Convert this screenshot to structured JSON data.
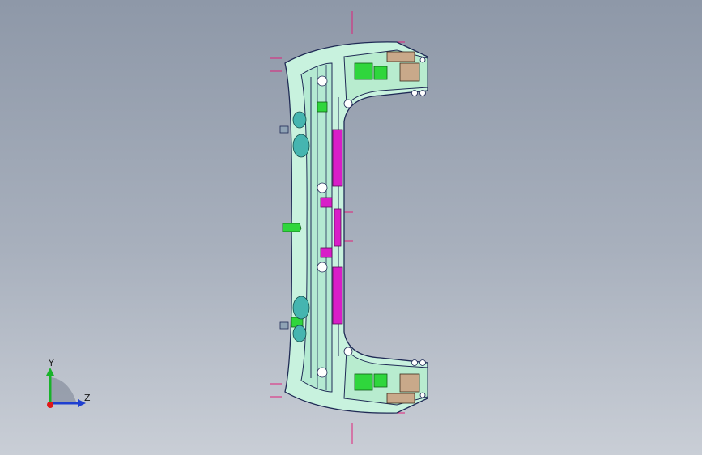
{
  "viewport": {
    "background_top": "#8e98a8",
    "background_bottom": "#c9ced6",
    "model": {
      "body_color": "#c8f2de",
      "outline_color": "#1f2a55",
      "green_part_color": "#2fd63c",
      "magenta_part_color": "#d81ec8",
      "tan_part_color": "#c9a98a",
      "cyan_part_color": "#45b5b0",
      "centerline_color": "#e0207a"
    }
  },
  "triad": {
    "y_label": "Y",
    "z_label": "Z",
    "y_color": "#18b22a",
    "z_color": "#1e3fd0",
    "x_color": "#e01818"
  }
}
